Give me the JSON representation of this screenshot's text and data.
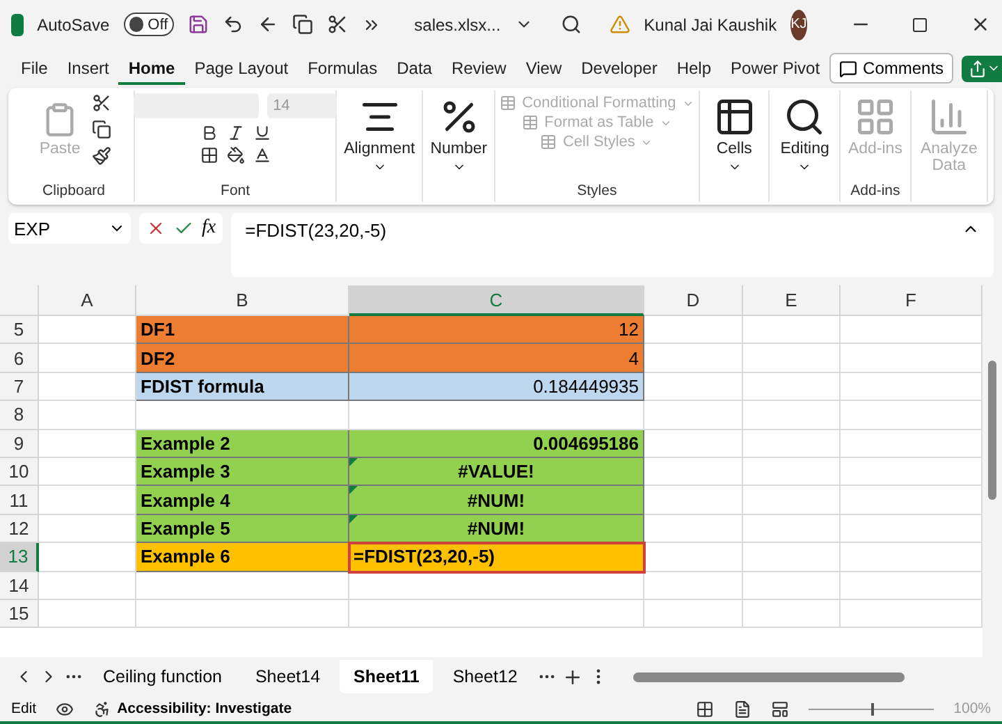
{
  "title_bar": {
    "autosave_label": "AutoSave",
    "autosave": {
      "label": "Off",
      "on": false
    },
    "filename": "sales.xlsx...",
    "user": "Kunal Jai Kaushik",
    "initials": "KJ"
  },
  "menu": {
    "tabs": [
      {
        "label": "File",
        "selected": false
      },
      {
        "label": "Insert",
        "selected": false
      },
      {
        "label": "Home",
        "selected": true
      },
      {
        "label": "Page Layout",
        "selected": false
      },
      {
        "label": "Formulas",
        "selected": false
      },
      {
        "label": "Data",
        "selected": false
      },
      {
        "label": "Review",
        "selected": false
      },
      {
        "label": "View",
        "selected": false
      },
      {
        "label": "Developer",
        "selected": false
      },
      {
        "label": "Help",
        "selected": false
      },
      {
        "label": "Power Pivot",
        "selected": false
      }
    ],
    "comments": "Comments"
  },
  "ribbon": {
    "groups": [
      {
        "kind": "clipboard",
        "name": "Clipboard",
        "paste": "Paste",
        "disabled": true
      },
      {
        "kind": "font",
        "name": "Font",
        "font_size": "14",
        "disabled": true
      },
      {
        "kind": "alignment",
        "label": "Alignment",
        "disabled": false
      },
      {
        "kind": "number",
        "label": "Number",
        "disabled": false
      },
      {
        "kind": "styles",
        "name": "Styles",
        "items": [
          "Conditional Formatting",
          "Format as Table",
          "Cell Styles"
        ],
        "disabled": true
      },
      {
        "kind": "cells",
        "label": "Cells",
        "disabled": false
      },
      {
        "kind": "editing",
        "label": "Editing",
        "disabled": false
      },
      {
        "kind": "addins",
        "label": "Add-ins",
        "name": "Add-ins",
        "disabled": true
      },
      {
        "kind": "analyze",
        "label": "Analyze Data",
        "disabled": true
      }
    ]
  },
  "formula_bar": {
    "name_box": "EXP",
    "fx": "fx",
    "formula": "=FDIST(23,20,-5)"
  },
  "sheet": {
    "columns": [
      {
        "label": "A",
        "selected": false
      },
      {
        "label": "B",
        "selected": false
      },
      {
        "label": "C",
        "selected": true
      },
      {
        "label": "D",
        "selected": false
      },
      {
        "label": "E",
        "selected": false
      },
      {
        "label": "F",
        "selected": false
      }
    ],
    "rows": [
      {
        "number": "5",
        "selected": false,
        "color": "#ed7d31",
        "label": "DF1",
        "value": "12",
        "kind": "number",
        "error_flag": false
      },
      {
        "number": "6",
        "selected": false,
        "color": "#ed7d31",
        "label": "DF2",
        "value": "4",
        "kind": "number",
        "error_flag": false
      },
      {
        "number": "7",
        "selected": false,
        "color": "#bdd7ee",
        "label": "FDIST formula",
        "value": "0.184449935",
        "kind": "number",
        "error_flag": false
      },
      {
        "number": "8",
        "selected": false
      },
      {
        "number": "9",
        "selected": false,
        "color": "#92d050",
        "label": "Example 2",
        "value": "0.004695186",
        "kind": "bold",
        "error_flag": false
      },
      {
        "number": "10",
        "selected": false,
        "color": "#92d050",
        "label": "Example 3",
        "value": "#VALUE!",
        "kind": "error",
        "error_flag": true
      },
      {
        "number": "11",
        "selected": false,
        "color": "#92d050",
        "label": "Example 4",
        "value": "#NUM!",
        "kind": "error",
        "error_flag": true
      },
      {
        "number": "12",
        "selected": false,
        "color": "#92d050",
        "label": "Example 5",
        "value": "#NUM!",
        "kind": "error",
        "error_flag": true
      },
      {
        "number": "13",
        "selected": true,
        "color": "#ffc000",
        "label": "Example 6",
        "value": "=FDIST(23,20,-5)",
        "kind": "edit",
        "error_flag": false
      },
      {
        "number": "14",
        "selected": false
      },
      {
        "number": "15",
        "selected": false
      }
    ]
  },
  "sheet_tabs": [
    {
      "label": "Ceiling function",
      "selected": false
    },
    {
      "label": "Sheet14",
      "selected": false
    },
    {
      "label": "Sheet11",
      "selected": true
    },
    {
      "label": "Sheet12",
      "selected": false
    }
  ],
  "status_bar": {
    "mode": "Edit",
    "accessibility": "Accessibility: Investigate",
    "level": 0.5,
    "zoom": "100%"
  }
}
